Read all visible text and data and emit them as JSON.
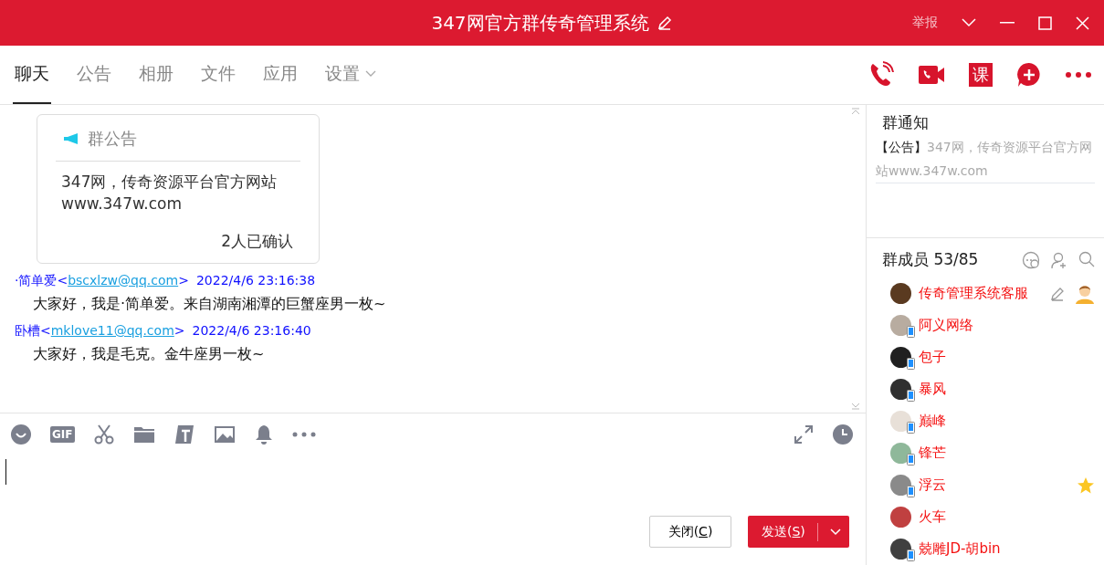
{
  "window": {
    "title": "347网官方群传奇管理系统",
    "report": "举报"
  },
  "tabs": [
    {
      "label": "聊天",
      "selected": true,
      "dropdown": false
    },
    {
      "label": "公告",
      "selected": false,
      "dropdown": false
    },
    {
      "label": "相册",
      "selected": false,
      "dropdown": false
    },
    {
      "label": "文件",
      "selected": false,
      "dropdown": false
    },
    {
      "label": "应用",
      "selected": false,
      "dropdown": false
    },
    {
      "label": "设置",
      "selected": false,
      "dropdown": true
    }
  ],
  "toolbar_actions": [
    {
      "kind": "phone"
    },
    {
      "kind": "video"
    },
    {
      "kind": "lesson",
      "label": "课"
    },
    {
      "kind": "add"
    },
    {
      "kind": "more"
    }
  ],
  "announcement_card": {
    "title": "群公告",
    "body": "347网，传奇资源平台官方网站www.347w.com",
    "confirmed": "2人已确认"
  },
  "messages": [
    {
      "sender": "·简单爱",
      "lt": "<",
      "email": "bscxlzw@qq.com",
      "gt": ">",
      "time": "2022/4/6 23:16:38",
      "text": "大家好，我是·简单爱。来自湖南湘潭的巨蟹座男一枚~"
    },
    {
      "sender": "卧槽",
      "lt": "<",
      "email": "mklove11@qq.com",
      "gt": ">",
      "time": "2022/4/6 23:16:40",
      "text": "大家好，我是毛克。金牛座男一枚~"
    }
  ],
  "input_toolbar": [
    {
      "kind": "emoji"
    },
    {
      "kind": "gif",
      "label": "GIF"
    },
    {
      "kind": "scissors"
    },
    {
      "kind": "folder"
    },
    {
      "kind": "doc"
    },
    {
      "kind": "image"
    },
    {
      "kind": "bell"
    },
    {
      "kind": "more"
    }
  ],
  "buttons": {
    "close": {
      "label": "关闭(",
      "key": "C",
      "end": ")"
    },
    "send": {
      "label": "发送(",
      "key": "S",
      "end": ")"
    }
  },
  "notice": {
    "title": "群通知",
    "tag": "【公告】",
    "text": "347网，传奇资源平台官方网站www.347w.com"
  },
  "members": {
    "title": "群成员 53/85",
    "items": [
      {
        "name": "传奇管理系统客服",
        "color": "#5a3a20",
        "mobile": false,
        "kind": "owner"
      },
      {
        "name": "阿义网络",
        "color": "#b8aca0",
        "mobile": true,
        "kind": "member"
      },
      {
        "name": "包子",
        "color": "#202020",
        "mobile": true,
        "kind": "member"
      },
      {
        "name": "暴风",
        "color": "#303030",
        "mobile": true,
        "kind": "member"
      },
      {
        "name": "巅峰",
        "color": "#e8e0d8",
        "mobile": true,
        "kind": "member"
      },
      {
        "name": "锋芒",
        "color": "#8fb89a",
        "mobile": true,
        "kind": "member"
      },
      {
        "name": "浮云",
        "color": "#8a8a8a",
        "mobile": true,
        "kind": "starred"
      },
      {
        "name": "火车",
        "color": "#c04040",
        "mobile": false,
        "kind": "member"
      },
      {
        "name": "兢雕JD-胡bin",
        "color": "#404040",
        "mobile": true,
        "kind": "member"
      }
    ]
  }
}
